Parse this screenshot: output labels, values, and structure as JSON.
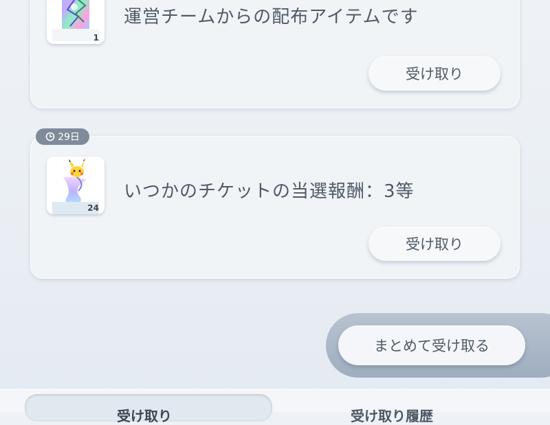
{
  "items": [
    {
      "title": "運営チームからの配布アイテムです",
      "count": "1",
      "claim_label": "受け取り",
      "thumb_icon": "holo-card-icon"
    },
    {
      "timer": "29日",
      "title": "いつかのチケットの当選報酬：3等",
      "count": "24",
      "claim_label": "受け取り",
      "thumb_icon": "hourglass-ticket-icon"
    }
  ],
  "bulk_claim_label": "まとめて受け取る",
  "tabs": [
    {
      "label": "受け取り"
    },
    {
      "label": "受け取り履歴"
    }
  ],
  "colors": {
    "card_bg": "#f1f4f7",
    "text": "#4f5a66",
    "badge_bg": "#7f8b9a",
    "bulk_wrap": "#a8b5c6"
  }
}
